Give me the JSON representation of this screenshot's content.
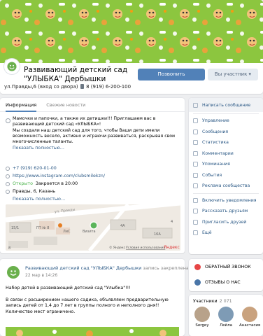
{
  "group": {
    "title": "Развивающий детский сад \"УЛЫБКА\" Дербышки",
    "address_line": "ул.Правды,6 (вход со двора)",
    "phone_line": "8 (919) 6-200-100",
    "subscribe_label": "Позвонить",
    "member_label": "Вы участник ▾"
  },
  "tabs": [
    {
      "label": "Информация"
    },
    {
      "label": "Свежие новости"
    }
  ],
  "info": {
    "description": "Мамочки и папочки, а также их детишки!!! Приглашаем вас в развивающий детский сад «УЛЫБКА»!\nМы создали наш детский сад для того, чтобы Ваши дети имели возможность весело, активно и играючи развиваться, раскрывая свои многочисленные таланты.",
    "more_label": "Показать полностью…",
    "phone": "+7 (919) 620-01-00",
    "website": "https://www.instagram.com/clubsmilekzn/",
    "status_open": "Открыто",
    "status_close": "Закроется в 20:00",
    "address": "Правды, 6, Казань",
    "address_more": "Показать полностью…"
  },
  "map": {
    "labels": [
      "15/1",
      "ГП № 8",
      "ЛиС",
      "Визита",
      "4А",
      "16А",
      "4",
      "8",
      "ул. Правды"
    ],
    "yandex": "© Яндекс",
    "terms": "Условия использования",
    "brand": "Яндекс"
  },
  "menu": {
    "primary": "Написать сообщение",
    "items": [
      "Управление",
      "Сообщения",
      "Статистика",
      "Комментарии",
      "Упоминания",
      "События",
      "Реклама сообщества"
    ],
    "items2": [
      "Включить уведомления",
      "Рассказать друзьям",
      "Пригласить друзей",
      "Ещё"
    ]
  },
  "post": {
    "author": "Развивающий детский сад \"УЛЫБКА\" Дербышки",
    "pinned": "запись закреплена",
    "date": "22 мар в 14:26",
    "text": "Набор детей в развивающий детский сад \"Улыбка\"!!!\n\nВ связи с расширением нашего садика, объявляем предварительную запись детей от 1,4 до 7 лет в группы полного и неполного дня!!\nКоличество мест ограничено."
  },
  "cta": {
    "call_label": "ОБРАТНЫЙ ЗВОНОК",
    "reviews_label": "ОТЗЫВЫ О НАС"
  },
  "members": {
    "title": "Участники",
    "count": "2 071",
    "list": [
      {
        "name": "Sergey"
      },
      {
        "name": "Лейла"
      },
      {
        "name": "Анастасия"
      }
    ]
  },
  "colors": {
    "accent": "#5181b8",
    "link": "#2a5885",
    "open": "#4bb34b",
    "cover": "#8cc63f",
    "call_icon": "#e64646",
    "reviews_icon": "#4a76a8"
  }
}
